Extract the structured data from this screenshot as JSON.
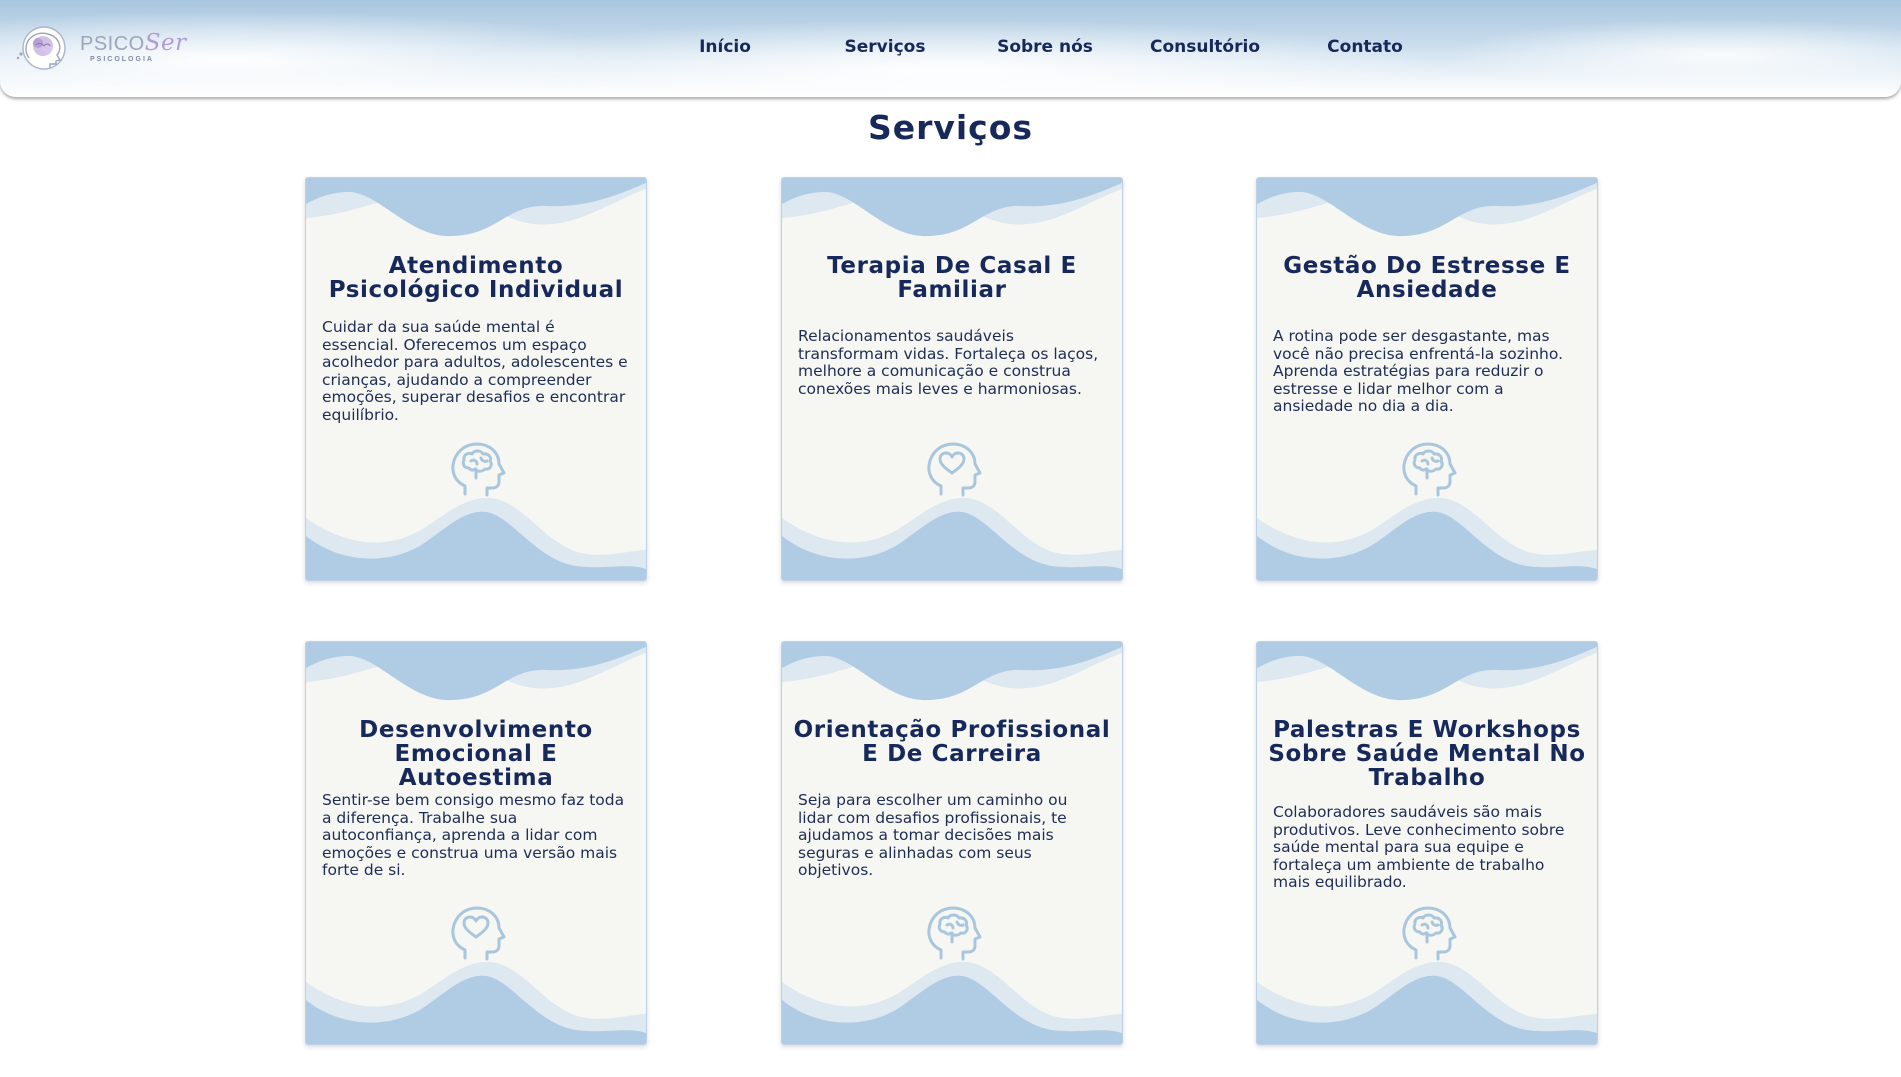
{
  "brand": {
    "name_main": "PSICO",
    "name_accent": "Ser",
    "tagline": "PSICOLOGIA"
  },
  "nav": {
    "items": [
      {
        "label": "Início"
      },
      {
        "label": "Serviços"
      },
      {
        "label": "Sobre nós"
      },
      {
        "label": "Consultório"
      },
      {
        "label": "Contato"
      }
    ]
  },
  "section": {
    "title": "Serviços"
  },
  "cards": [
    {
      "title": "Atendimento Psicológico Individual",
      "description": "Cuidar da sua saúde mental é essencial. Oferecemos um espaço acolhedor para adultos, adolescentes e crianças, ajudando a compreender emoções, superar desafios e encontrar equilíbrio.",
      "icon": "head-brain-icon"
    },
    {
      "title": "Terapia De Casal E Familiar",
      "description": "Relacionamentos saudáveis transformam vidas. Fortaleça os laços, melhore a comunicação e construa conexões mais leves e harmoniosas.",
      "icon": "head-heart-icon"
    },
    {
      "title": "Gestão Do Estresse E Ansiedade",
      "description": "A rotina pode ser desgastante, mas você não precisa enfrentá-la sozinho. Aprenda estratégias para reduzir o estresse e lidar melhor com a ansiedade no dia a dia.",
      "icon": "head-brain-icon"
    },
    {
      "title": "Desenvolvimento Emocional E Autoestima",
      "description": "Sentir-se bem consigo mesmo faz toda a diferença. Trabalhe sua autoconfiança, aprenda a lidar com emoções e construa uma versão mais forte de si.",
      "icon": "head-heart-icon"
    },
    {
      "title": "Orientação Profissional E De Carreira",
      "description": "Seja para escolher um caminho ou lidar com desafios profissionais, te ajudamos a tomar decisões mais seguras e alinhadas com seus objetivos.",
      "icon": "head-brain-icon"
    },
    {
      "title": "Palestras E Workshops Sobre Saúde Mental No Trabalho",
      "description": "Colaboradores saudáveis são mais produtivos. Leve conhecimento sobre saúde mental para sua equipe e fortaleça um ambiente de trabalho mais equilibrado.",
      "icon": "head-brain-icon"
    }
  ],
  "colors": {
    "navy": "#17285a",
    "wave_blue": "#b0cce4",
    "wave_light": "#dde8f0",
    "card_bg": "#f6f7f2"
  }
}
